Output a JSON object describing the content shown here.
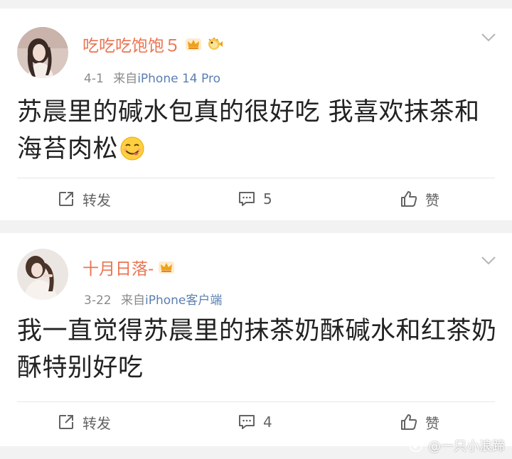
{
  "colors": {
    "username": "#eb7350",
    "source_link": "#5a7fb0",
    "meta_gray": "#8b8b8b",
    "action_gray": "#636363"
  },
  "posts": [
    {
      "username": "吃吃吃饱饱５",
      "badges": [
        "crown-icon",
        "pufferfish-icon"
      ],
      "date": "4-1",
      "source_prefix": "来自",
      "source": "iPhone 14 Pro",
      "content": "苏晨里的碱水包真的很好吃 我喜欢抹茶和海苔肉松",
      "emoji": "yum-face-emoji",
      "actions": {
        "forward_label": "转发",
        "comment_count": "5",
        "like_label": "赞"
      }
    },
    {
      "username": "十月日落-",
      "badges": [
        "crown-icon"
      ],
      "date": "3-22",
      "source_prefix": "来自",
      "source": "iPhone客户端",
      "content": "我一直觉得苏晨里的抹茶奶酥碱水和红茶奶酥特别好吃",
      "actions": {
        "forward_label": "转发",
        "comment_count": "4",
        "like_label": "赞"
      }
    }
  ],
  "watermark": "@一只小浪蹄"
}
